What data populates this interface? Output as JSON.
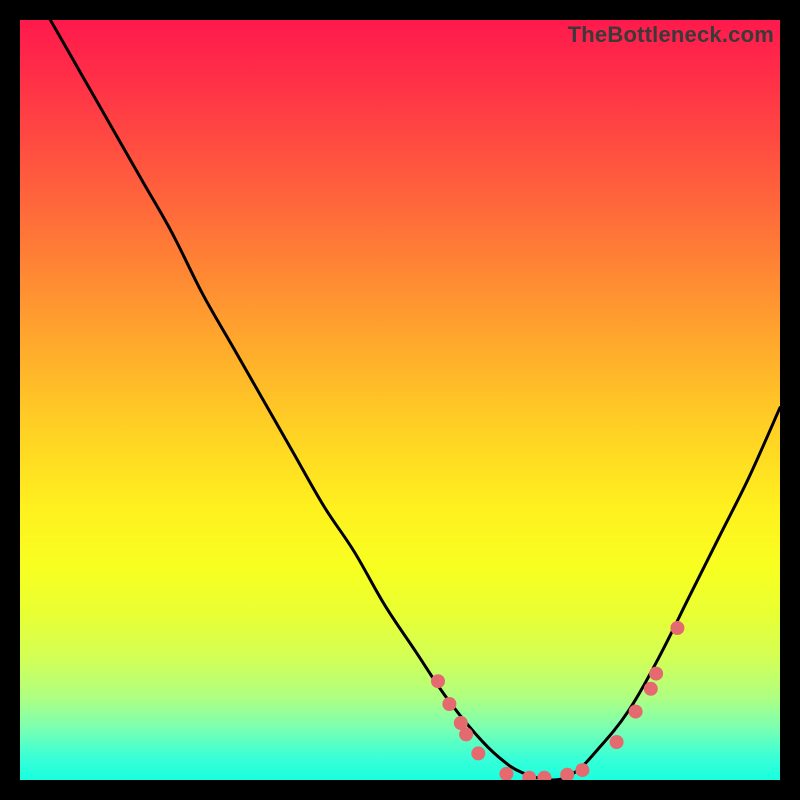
{
  "attribution": "TheBottleneck.com",
  "chart_data": {
    "type": "line",
    "title": "",
    "xlabel": "",
    "ylabel": "",
    "xlim": [
      0,
      100
    ],
    "ylim": [
      0,
      100
    ],
    "curve": {
      "name": "bottleneck-curve",
      "x": [
        4,
        8,
        12,
        16,
        20,
        24,
        28,
        32,
        36,
        40,
        44,
        48,
        52,
        56,
        60,
        63,
        66,
        70,
        73,
        76,
        80,
        84,
        88,
        92,
        96,
        100
      ],
      "y": [
        100,
        93,
        86,
        79,
        72,
        64,
        57,
        50,
        43,
        36,
        30,
        23,
        17,
        11,
        6,
        3,
        1,
        0,
        1,
        4,
        9,
        16,
        24,
        32,
        40,
        49
      ]
    },
    "markers": {
      "name": "data-points",
      "color": "#e46a6f",
      "radius": 7,
      "points": [
        {
          "x": 55,
          "y": 13
        },
        {
          "x": 56.5,
          "y": 10
        },
        {
          "x": 58,
          "y": 7.5
        },
        {
          "x": 58.7,
          "y": 6
        },
        {
          "x": 60.3,
          "y": 3.5
        },
        {
          "x": 64,
          "y": 0.8
        },
        {
          "x": 67,
          "y": 0.3
        },
        {
          "x": 69,
          "y": 0.3
        },
        {
          "x": 72,
          "y": 0.7
        },
        {
          "x": 74,
          "y": 1.3
        },
        {
          "x": 78.5,
          "y": 5
        },
        {
          "x": 81,
          "y": 9
        },
        {
          "x": 83,
          "y": 12
        },
        {
          "x": 83.7,
          "y": 14
        },
        {
          "x": 86.5,
          "y": 20
        }
      ]
    },
    "background_gradient": {
      "type": "vertical",
      "stops": [
        {
          "pos": 0.0,
          "color": "#ff1a4d"
        },
        {
          "pos": 0.34,
          "color": "#ff8a33"
        },
        {
          "pos": 0.64,
          "color": "#fff01f"
        },
        {
          "pos": 0.89,
          "color": "#b0ff80"
        },
        {
          "pos": 1.0,
          "color": "#19ffdf"
        }
      ]
    }
  }
}
